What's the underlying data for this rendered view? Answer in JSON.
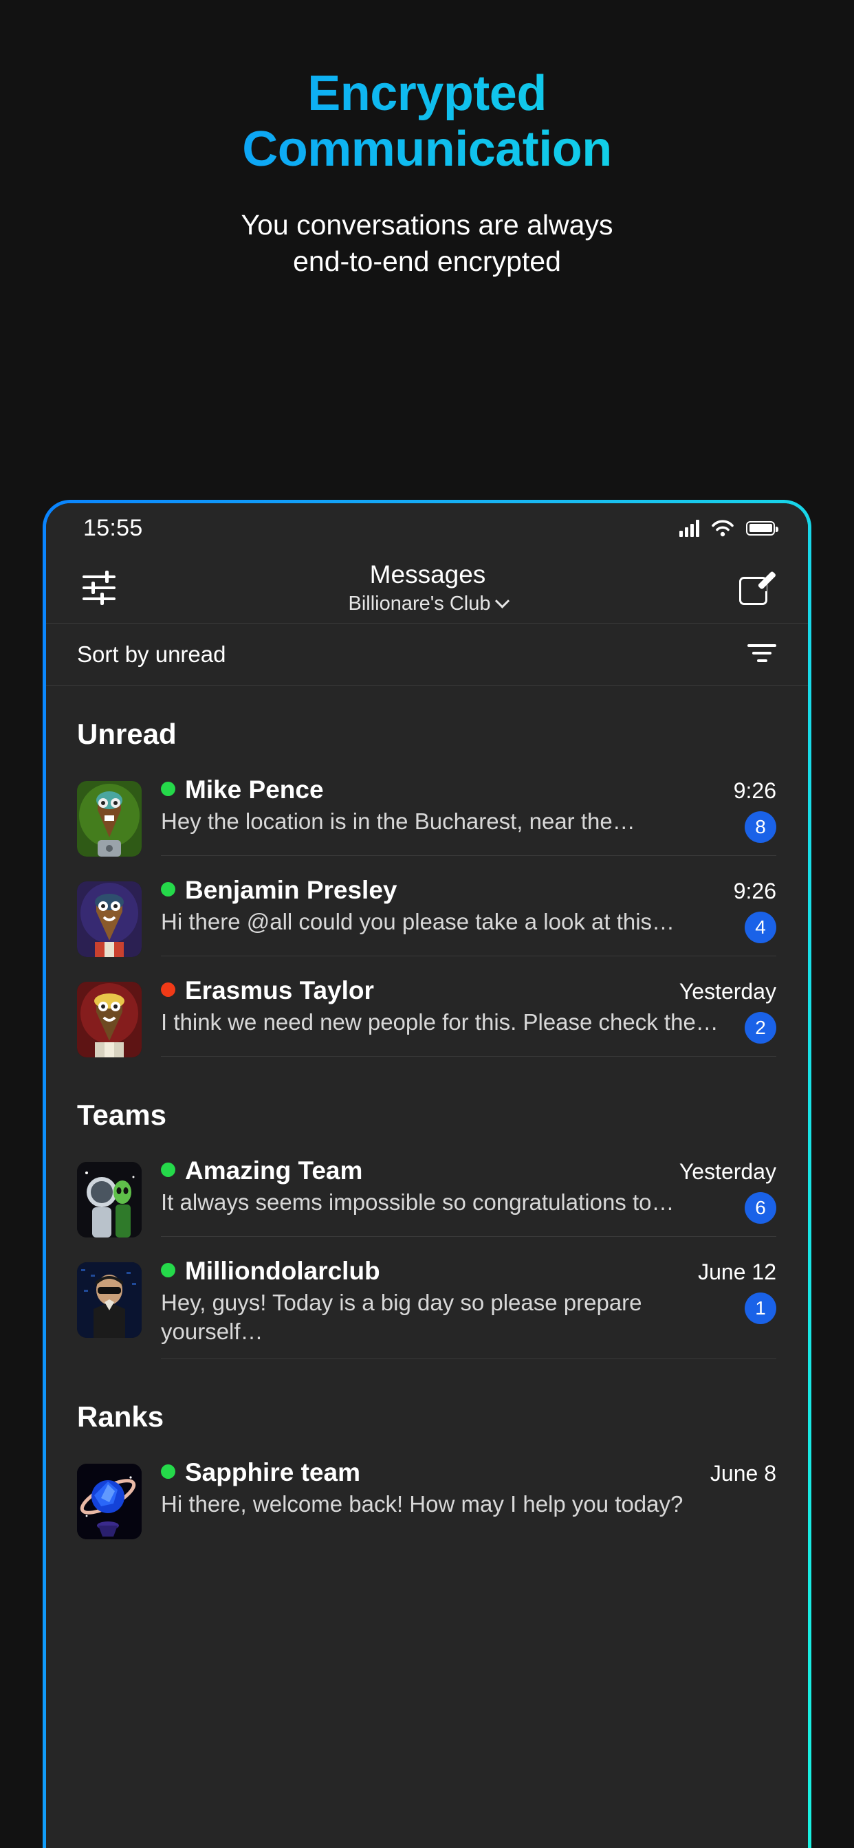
{
  "promo": {
    "title_line1": "Encrypted",
    "title_line2": "Communication",
    "subtitle_line1": "You conversations are always",
    "subtitle_line2": "end-to-end encrypted",
    "gradient_start": "#0a84ff",
    "gradient_end": "#16e7e0"
  },
  "status_bar": {
    "time": "15:55",
    "icons": [
      "signal-icon",
      "wifi-icon",
      "battery-icon"
    ]
  },
  "app_bar": {
    "filter_icon": "filter-sliders-icon",
    "title": "Messages",
    "subtitle": "Billionare's Club",
    "chevron_icon": "chevron-down-icon",
    "compose_icon": "compose-icon"
  },
  "sort_bar": {
    "label": "Sort by unread",
    "icon": "sort-descending-icon"
  },
  "sections": [
    {
      "title": "Unread",
      "rows": [
        {
          "avatar": "alien-green-avatar",
          "status_color": "#25d94a",
          "name": "Mike Pence",
          "time": "9:26",
          "preview": "Hey the location is in the Bucharest, near the…",
          "badge": "8"
        },
        {
          "avatar": "alien-purple-avatar",
          "status_color": "#25d94a",
          "name": "Benjamin Presley",
          "time": "9:26",
          "preview": "Hi there @all could you please take a look at this…",
          "badge": "4"
        },
        {
          "avatar": "alien-red-avatar",
          "status_color": "#f03a17",
          "name": "Erasmus Taylor",
          "time": "Yesterday",
          "preview": "I think we need new people for this. Please check the…",
          "badge": "2"
        }
      ]
    },
    {
      "title": "Teams",
      "rows": [
        {
          "avatar": "astronaut-team-avatar",
          "status_color": "#25d94a",
          "name": "Amazing Team",
          "time": "Yesterday",
          "preview": "It always seems impossible so congratulations to…",
          "badge": "6"
        },
        {
          "avatar": "hacker-avatar",
          "status_color": "#25d94a",
          "name": "Milliondolarclub",
          "time": "June 12",
          "preview": "Hey, guys! Today is a big day so please prepare yourself…",
          "badge": "1"
        }
      ]
    },
    {
      "title": "Ranks",
      "rows": [
        {
          "avatar": "sapphire-planet-avatar",
          "status_color": "#25d94a",
          "name": "Sapphire team",
          "time": "June 8",
          "preview": "Hi there, welcome back! How may I help you today?",
          "badge": ""
        }
      ]
    }
  ]
}
